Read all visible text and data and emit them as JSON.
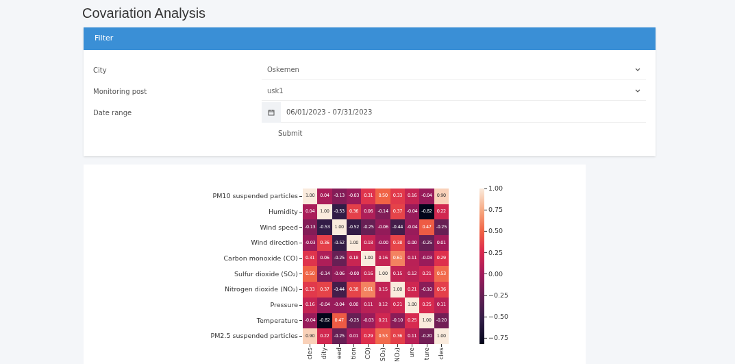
{
  "page_title": "Covariation Analysis",
  "filter": {
    "title": "Filter",
    "fields": [
      {
        "kind": "select",
        "label": "City",
        "value": "Oskemen"
      },
      {
        "kind": "select",
        "label": "Monitoring post",
        "value": "usk1"
      },
      {
        "kind": "date",
        "label": "Date range",
        "value": "06/01/2023 - 07/31/2023"
      }
    ],
    "submit": "Submit"
  },
  "heatmap": {
    "row_labels": [
      "PM10 suspended particles",
      "Humidity",
      "Wind speed",
      "Wind direction",
      "Carbon monoxide (CO)",
      "Sulfur dioxide (SO₂)",
      "Nitrogen dioxide (NO₂)",
      "Pressure",
      "Temperature",
      "PM2.5 suspended particles"
    ],
    "column_labels": [
      "cles",
      "dity",
      "eed",
      "tion",
      "CO)",
      "SO₂)",
      "NO₂)",
      "ure",
      "ture",
      "cles"
    ],
    "rows": [
      [
        "1.00",
        "0.04",
        "-0.13",
        "-0.03",
        "0.31",
        "0.50",
        "0.33",
        "0.16",
        "-0.04",
        "0.90"
      ],
      [
        "0.04",
        "1.00",
        "-0.53",
        "0.36",
        "0.06",
        "-0.14",
        "0.37",
        "-0.04",
        "-0.82",
        "0.22"
      ],
      [
        "-0.13",
        "-0.53",
        "1.00",
        "-0.52",
        "-0.25",
        "-0.06",
        "-0.44",
        "-0.04",
        "0.47",
        "-0.25"
      ],
      [
        "-0.03",
        "0.36",
        "-0.52",
        "1.00",
        "0.18",
        "-0.00",
        "0.38",
        "0.00",
        "-0.25",
        "0.01"
      ],
      [
        "0.31",
        "0.06",
        "-0.25",
        "0.18",
        "1.00",
        "0.16",
        "0.61",
        "0.11",
        "-0.03",
        "0.29"
      ],
      [
        "0.50",
        "-0.14",
        "-0.06",
        "-0.00",
        "0.16",
        "1.00",
        "0.15",
        "0.12",
        "0.21",
        "0.53"
      ],
      [
        "0.33",
        "0.37",
        "-0.44",
        "0.38",
        "0.61",
        "0.15",
        "1.00",
        "0.21",
        "-0.10",
        "0.36"
      ],
      [
        "0.16",
        "-0.04",
        "-0.04",
        "0.00",
        "0.11",
        "0.12",
        "0.21",
        "1.00",
        "0.25",
        "0.11"
      ],
      [
        "-0.04",
        "-0.82",
        "0.47",
        "-0.25",
        "-0.03",
        "0.21",
        "-0.10",
        "0.25",
        "1.00",
        "-0.20"
      ],
      [
        "0.90",
        "0.22",
        "-0.25",
        "0.01",
        "0.29",
        "0.53",
        "0.36",
        "0.11",
        "-0.20",
        "1.00"
      ]
    ],
    "colorbar_ticks": [
      "1.00",
      "0.75",
      "0.50",
      "0.25",
      "0.00",
      "−0.25",
      "−0.50",
      "−0.75"
    ]
  }
}
